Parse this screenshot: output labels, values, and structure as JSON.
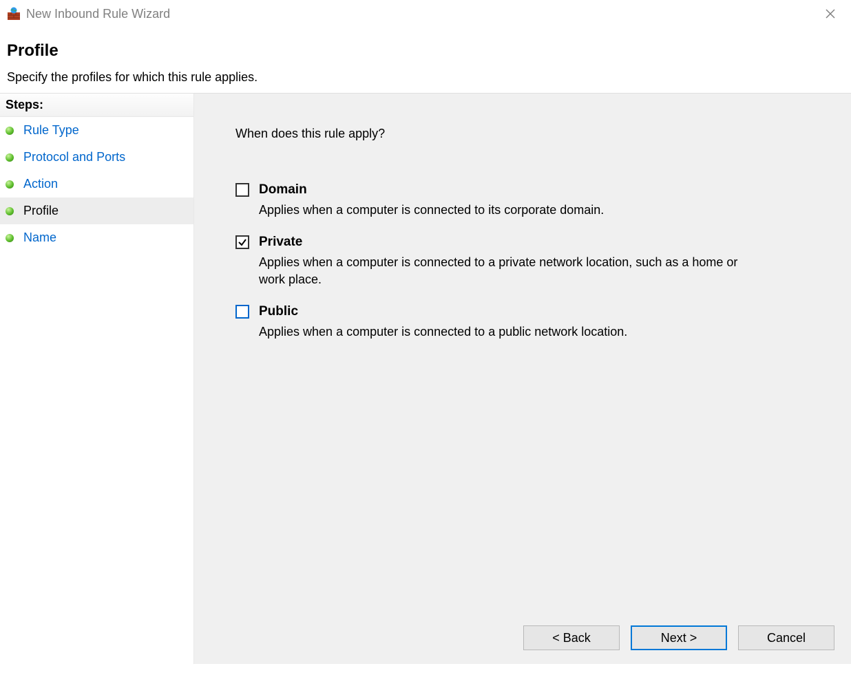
{
  "window": {
    "title": "New Inbound Rule Wizard"
  },
  "header": {
    "title": "Profile",
    "subtitle": "Specify the profiles for which this rule applies."
  },
  "sidebar": {
    "header": "Steps:",
    "steps": [
      {
        "label": "Rule Type",
        "current": false
      },
      {
        "label": "Protocol and Ports",
        "current": false
      },
      {
        "label": "Action",
        "current": false
      },
      {
        "label": "Profile",
        "current": true
      },
      {
        "label": "Name",
        "current": false
      }
    ]
  },
  "main": {
    "question": "When does this rule apply?",
    "options": [
      {
        "title": "Domain",
        "description": "Applies when a computer is connected to its corporate domain.",
        "checked": false,
        "accent": false
      },
      {
        "title": "Private",
        "description": "Applies when a computer is connected to a private network location, such as a home or work place.",
        "checked": true,
        "accent": false
      },
      {
        "title": "Public",
        "description": "Applies when a computer is connected to a public network location.",
        "checked": false,
        "accent": true
      }
    ]
  },
  "buttons": {
    "back": "< Back",
    "next": "Next >",
    "cancel": "Cancel"
  }
}
